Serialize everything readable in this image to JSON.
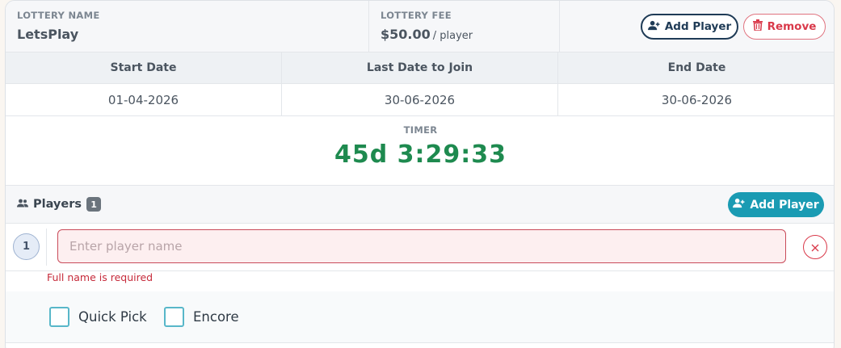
{
  "lottery": {
    "name_label": "LOTTERY NAME",
    "name": "LetsPlay",
    "fee_label": "LOTTERY FEE",
    "fee": "$50.00",
    "fee_suffix": "/ player"
  },
  "actions": {
    "add_player": "Add Player",
    "remove": "Remove"
  },
  "dates": {
    "headers": [
      "Start Date",
      "Last Date to Join",
      "End Date"
    ],
    "values": [
      "01-04-2026",
      "30-06-2026",
      "30-06-2026"
    ]
  },
  "timer": {
    "label": "TIMER",
    "value": "45d 3:29:33"
  },
  "players": {
    "title": "Players",
    "count": "1",
    "add_label": "Add Player",
    "rows": [
      {
        "number": "1",
        "value": "",
        "placeholder": "Enter player name",
        "error": "Full name is required"
      }
    ]
  },
  "options": {
    "quick_pick": "Quick Pick",
    "encore": "Encore"
  },
  "colors": {
    "primary_dark": "#1f3b56",
    "danger": "#d9394a",
    "accent": "#1a9bb3",
    "timer_green": "#1e8a4f"
  },
  "icons": [
    "user-plus-icon",
    "trash-icon",
    "users-icon",
    "close-icon"
  ]
}
